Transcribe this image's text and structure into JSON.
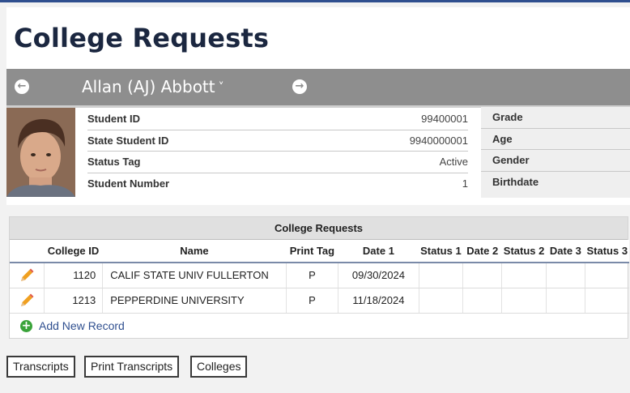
{
  "page": {
    "title": "College Requests"
  },
  "student": {
    "name": "Allan (AJ) Abbott",
    "chevron": "˅",
    "prev_icon": "arrow-left-circle",
    "next_icon": "arrow-right-circle",
    "fields": [
      {
        "label": "Student ID",
        "value": "99400001"
      },
      {
        "label": "State Student ID",
        "value": "9940000001"
      },
      {
        "label": "Status Tag",
        "value": "Active"
      },
      {
        "label": "Student Number",
        "value": "1"
      }
    ],
    "right_fields": [
      {
        "label": "Grade"
      },
      {
        "label": "Age"
      },
      {
        "label": "Gender"
      },
      {
        "label": "Birthdate"
      }
    ]
  },
  "grid": {
    "caption": "College Requests",
    "columns": [
      "",
      "College ID",
      "Name",
      "Print Tag",
      "Date 1",
      "Status 1",
      "Date 2",
      "Status 2",
      "Date 3",
      "Status 3"
    ],
    "rows": [
      {
        "college_id": "1120",
        "name": "CALIF STATE UNIV FULLERTON",
        "print_tag": "P",
        "date1": "09/30/2024",
        "status1": "",
        "date2": "",
        "status2": "",
        "date3": "",
        "status3": ""
      },
      {
        "college_id": "1213",
        "name": "PEPPERDINE UNIVERSITY",
        "print_tag": "P",
        "date1": "11/18/2024",
        "status1": "",
        "date2": "",
        "status2": "",
        "date3": "",
        "status3": ""
      }
    ],
    "add_label": "Add New Record",
    "add_icon": "+"
  },
  "buttons": {
    "transcripts": "Transcripts",
    "print_transcripts": "Print Transcripts",
    "colleges": "Colleges"
  },
  "colors": {
    "accent": "#2f4f8f",
    "bar": "#8e8e8e",
    "add_green": "#3aa33a",
    "pencil": "#f0a020"
  }
}
